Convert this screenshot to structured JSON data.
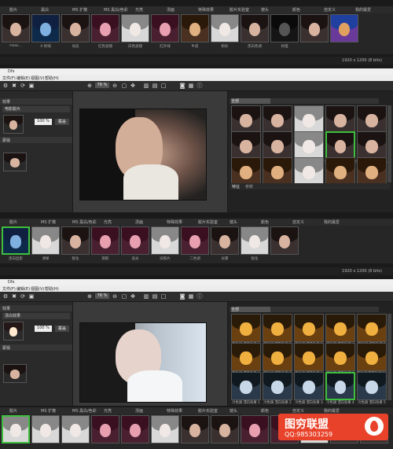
{
  "section1": {
    "categories": [
      "胶片",
      "黑白",
      "MS 扩散",
      "MS 黑白/色彩",
      "光亮",
      "漂画",
      "特殊效果",
      "胶片实验室",
      "镜头",
      "颜色",
      "自定义",
      "我的最爱"
    ],
    "thumbs": [
      {
        "label": "Haas...",
        "tone": "normal"
      },
      {
        "label": "X 射线",
        "tone": "blue"
      },
      {
        "label": "动态",
        "tone": "normal"
      },
      {
        "label": "红色滤镜",
        "tone": "pink"
      },
      {
        "label": "白色滤镜",
        "tone": "light"
      },
      {
        "label": "红外线",
        "tone": "pink"
      },
      {
        "label": "牛皮",
        "tone": "warm"
      },
      {
        "label": "粉彩",
        "tone": "light"
      },
      {
        "label": "黑白色调",
        "tone": "normal"
      },
      {
        "label": "纹理",
        "tone": "dark"
      },
      {
        "label": "",
        "tone": "normal"
      },
      {
        "label": "",
        "tone": "colorful"
      }
    ],
    "status": "1920 x 1200 (8 bits)"
  },
  "window2": {
    "title": "Dfx",
    "menu": [
      "文件(F)",
      "编辑(E)",
      "视图(V)",
      "帮助(H)"
    ],
    "zoom": "76 %",
    "left_head": "效果",
    "effect_name": "电影胶片",
    "value": "100 %",
    "apply_label": "覆盖",
    "mask_head": "蒙版",
    "right_head": "特征",
    "filter_select": "全部",
    "grid_labels": [
      "Sakura",
      "Temperature 2",
      "Temperature 3",
      "",
      "",
      "",
      "",
      "宝丽来 400",
      "宝丽来 400 Lomo LCA",
      "宝丽来 Lomo 胶片 100",
      "宝丽来 100 明亮",
      "宝丽来 100 暖调",
      "宝丽来 CT 胶片 100",
      "宝丽来 Cinema 100",
      "宝丽来 Precision 100",
      "宝丽来 R 100 红",
      "宝丽来 RGB 100 色调"
    ],
    "tabs": [
      "特征",
      "参数"
    ],
    "strip_categories": [
      "胶片",
      "MS 扩散",
      "MS 黑白/色彩",
      "光亮",
      "漂画",
      "特殊效果",
      "胶片实验室",
      "镜头",
      "颜色",
      "自定义",
      "我的最爱"
    ],
    "strip_labels": [
      "黑白显影",
      "清晰",
      "锐化",
      "阴影",
      "高光",
      "旧照片",
      "二色调",
      "光晕",
      "锐化",
      ""
    ],
    "status": "1920 x 1200 (8 bits)"
  },
  "window3": {
    "title": "Dfx",
    "menu": [
      "文件(F)",
      "编辑(E)",
      "视图(V)",
      "帮助(H)"
    ],
    "zoom": "76 %",
    "left_head": "效果",
    "effect_name": "漂白效果",
    "value": "100 %",
    "apply_label": "覆盖",
    "mask_head": "蒙版",
    "right_head": "特征",
    "filter_select": "全部",
    "grid_labels": [
      "暖色调 漂白效果 1",
      "暖色调 漂白效果 2",
      "暖色调 漂白效果 3",
      "暖色调 漂白效果 4",
      "暖色调 漂白效果 5",
      "暖色调 漂白效果 6",
      "暖色调 漂白效果 7",
      "暖色调 漂白效果 8",
      "暖色调 漂白效果 9",
      "暖色调 漂白效果 10",
      "冷色调 漂白效果 1",
      "冷色调 漂白效果 2",
      "冷色调 漂白效果 3",
      "冷色调 漂白效果 4",
      "冷色调 漂白效果 5"
    ],
    "strip_categories": [
      "胶片",
      "MS 扩散",
      "MS 黑白/色彩",
      "光亮",
      "漂画",
      "特殊效果",
      "胶片实验室",
      "镜头",
      "颜色",
      "自定义",
      "我的最爱"
    ]
  },
  "watermark": {
    "title": "图穷联盟",
    "qq": "QQ:985303259"
  }
}
